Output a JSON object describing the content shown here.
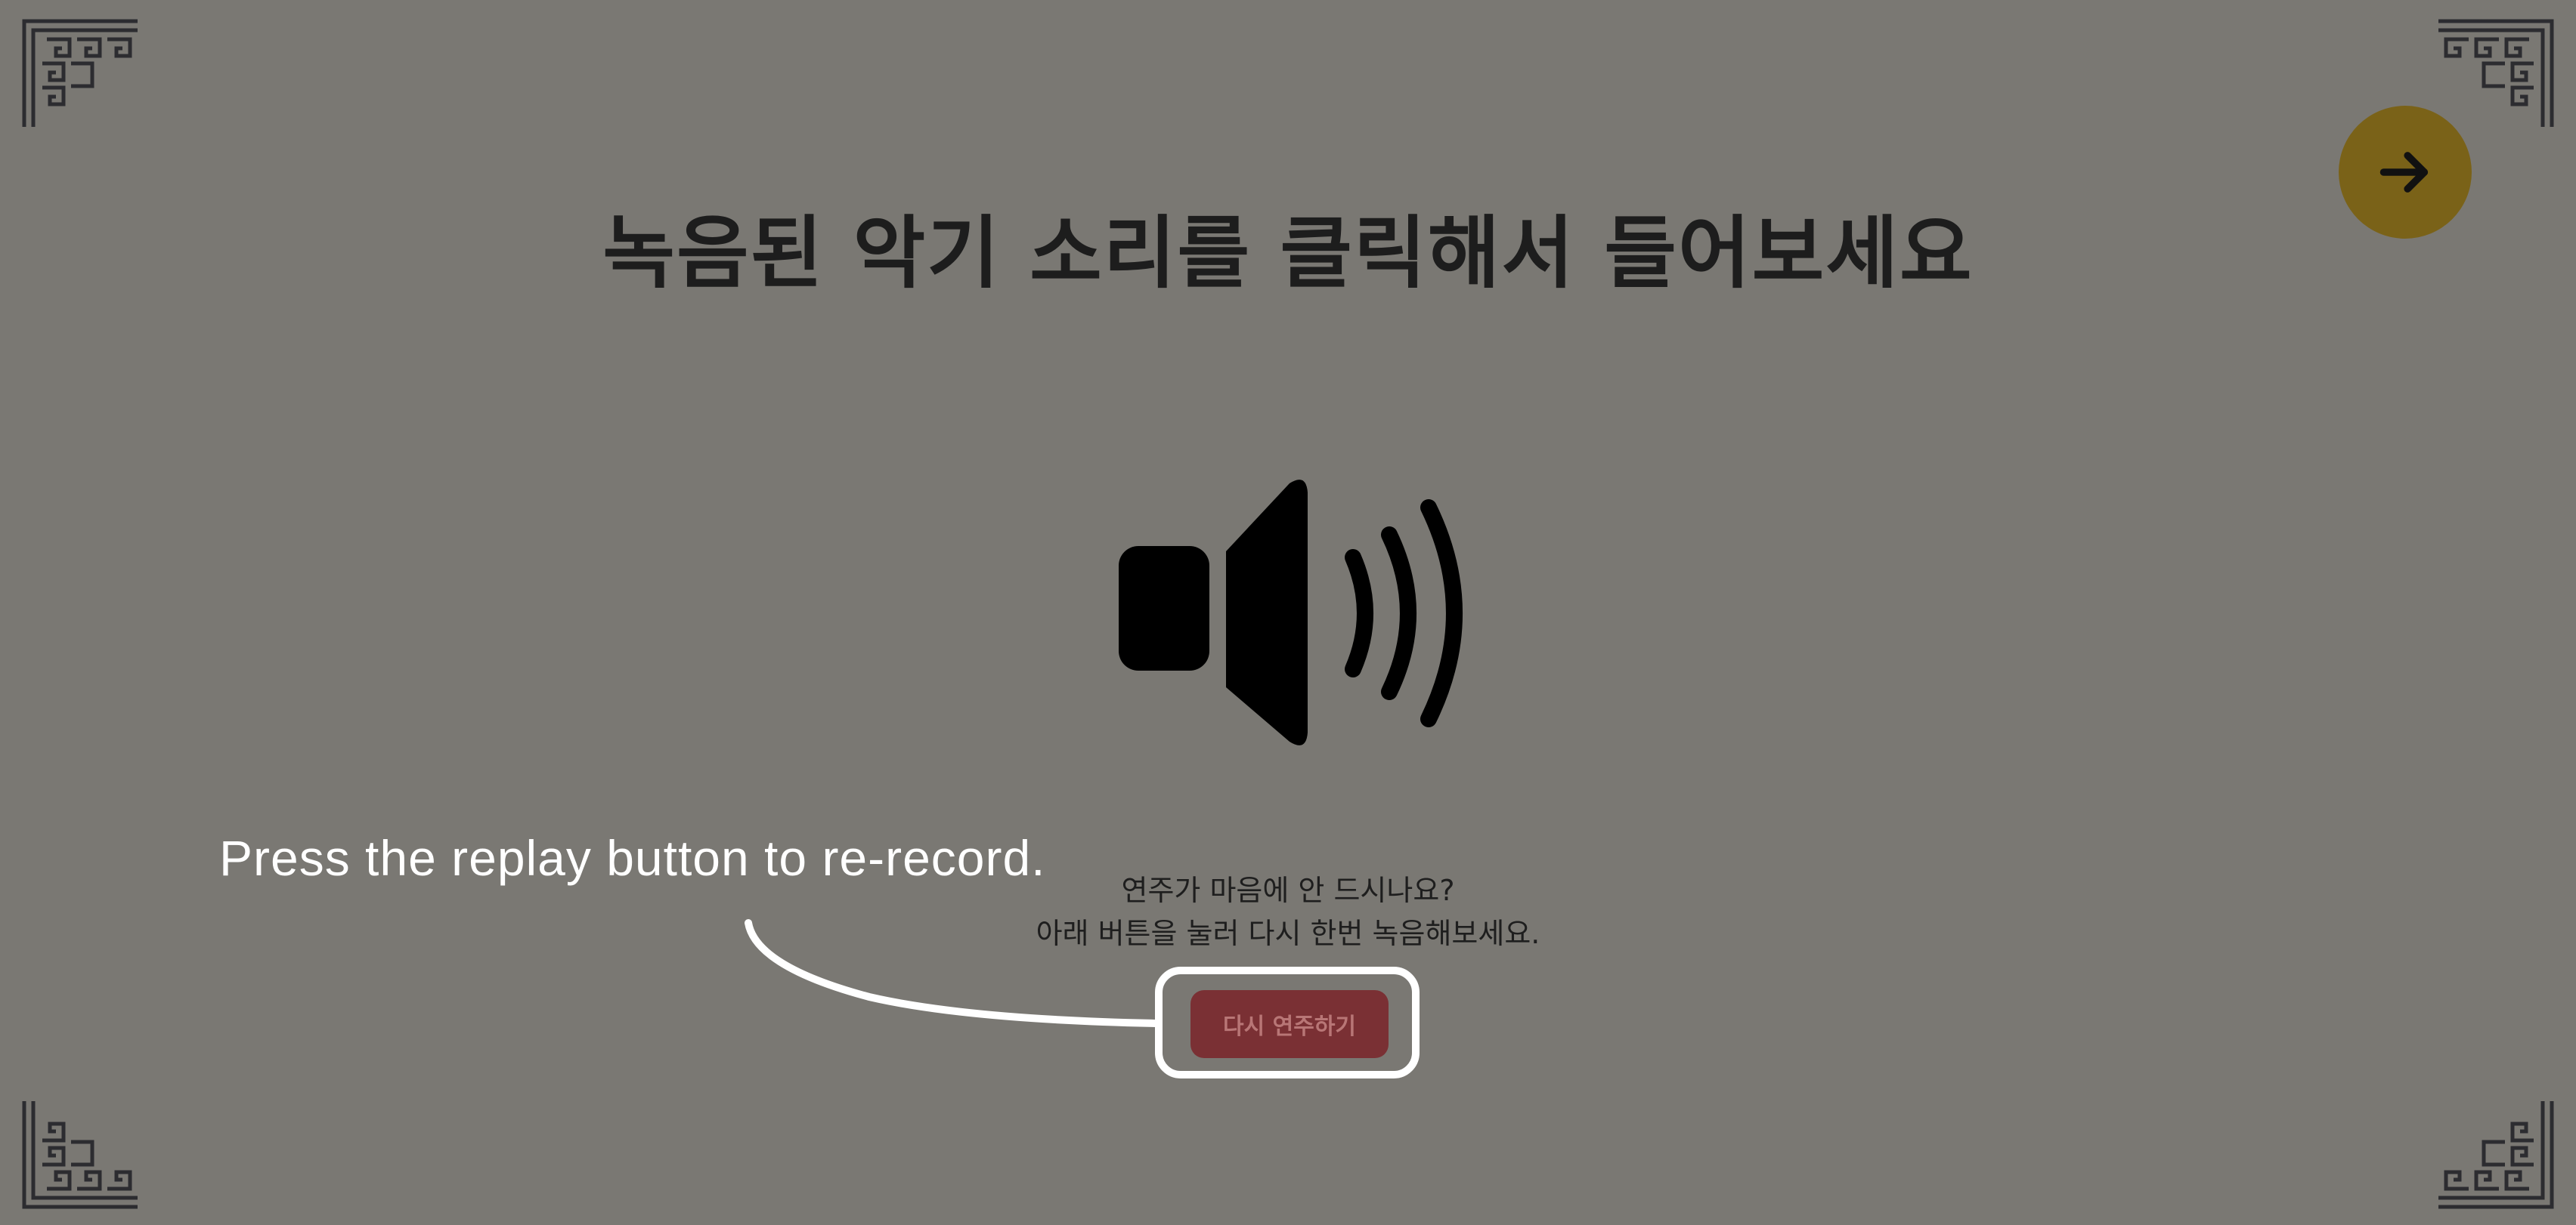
{
  "page": {
    "title": "녹음된 악기 소리를 클릭해서 들어보세요",
    "prompt_line1": "연주가 마음에 안 드시나요?",
    "prompt_line2": "아래 버튼을 눌러 다시 한번 녹음해보세요.",
    "replay_label": "다시 연주하기"
  },
  "annotation": {
    "text": "Press the replay button to re-record."
  },
  "icons": {
    "next": "arrow-right-icon",
    "speaker": "speaker-icon",
    "corner": "lattice-corner-ornament"
  },
  "colors": {
    "background": "#7a7873",
    "next_button": "#7a6218",
    "replay_button": "#7a3034",
    "annotation": "#ffffff"
  }
}
